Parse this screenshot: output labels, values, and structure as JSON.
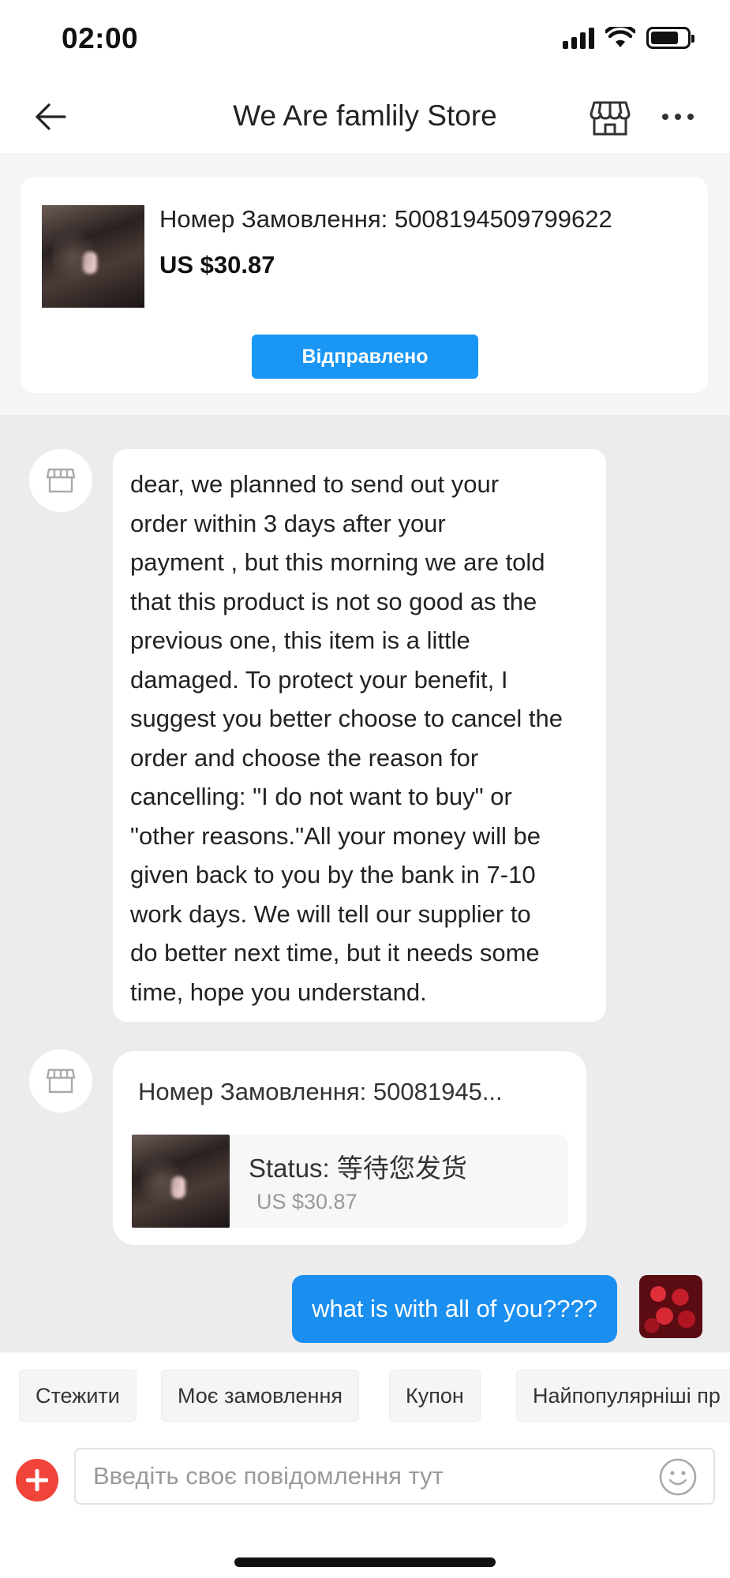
{
  "status_bar": {
    "time": "02:00",
    "icons": [
      "cellular-signal-icon",
      "wifi-icon",
      "battery-icon"
    ]
  },
  "header": {
    "back_icon": "arrow-left-icon",
    "title": "We Are famlily Store",
    "store_icon": "storefront-icon",
    "more_icon": "more-horizontal-icon"
  },
  "order_card": {
    "order_number": "Номер Замовлення: 5008194509799622",
    "price": "US $30.87",
    "status_button": "Відправлено"
  },
  "messages": [
    {
      "from": "store",
      "text": "dear, we planned to send out your order within 3 days after your payment , but this morning we are told that this product is not so good as the previous one, this item is a little damaged. To protect your benefit, I suggest you better choose to cancel the order and choose the reason for cancelling: \"I do not want to buy\" or \"other reasons.\"All your money will be given back to you by the bank in 7-10 work days. We will tell our supplier to do better next time, but it needs some time, hope you understand.",
      "lines": [
        "dear, we planned to send out your",
        "order within 3 days after your",
        "payment , but this morning we are told",
        "that this product is not so good as the",
        "previous one, this item is a little",
        "damaged. To protect your benefit, I",
        "suggest you better choose to cancel the",
        "order and choose the reason for",
        "cancelling: \"I do not want to buy\" or",
        "\"other reasons.\"All your money will be",
        "given back to you by the bank in 7-10",
        "work days. We will tell our supplier to",
        "do better next time, but it needs some",
        "time, hope you understand."
      ]
    },
    {
      "from": "store",
      "type": "order",
      "title": "Номер Замовлення:  50081945...",
      "status": "Status:  等待您发货",
      "price": "US $30.87"
    },
    {
      "from": "user",
      "text": "what is with all of you????"
    }
  ],
  "quick_replies": [
    "Стежити",
    "Моє замовлення",
    "Купон",
    "Найпопулярніші пр"
  ],
  "input": {
    "placeholder": "Введіть своє повідомлення тут",
    "value": "",
    "add_icon": "plus-circle-icon",
    "emoji_icon": "smiley-icon"
  },
  "colors": {
    "accent_blue": "#1a97f5",
    "outgoing_bubble": "#1a8ff0",
    "add_button_red": "#f0443a",
    "chat_background": "#ececec"
  }
}
